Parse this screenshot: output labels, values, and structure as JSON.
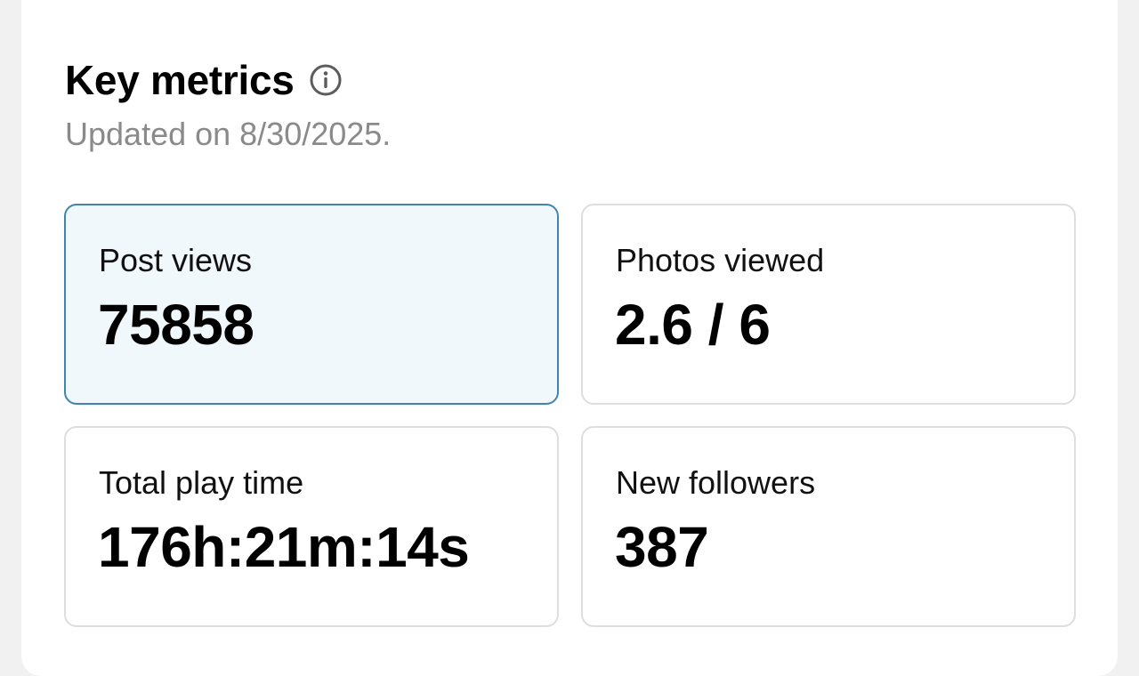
{
  "header": {
    "title": "Key metrics",
    "info_icon": "info-circle-icon",
    "updated_text": "Updated on 8/30/2025."
  },
  "colors": {
    "selected_card_bg": "#f1f8fb",
    "selected_card_border": "#3f85ac",
    "card_border": "#dedede",
    "subtitle_text": "#8a8a8a"
  },
  "metrics": [
    {
      "label": "Post views",
      "value": "75858",
      "selected": true
    },
    {
      "label": "Photos viewed",
      "value": "2.6 / 6",
      "selected": false
    },
    {
      "label": "Total play time",
      "value": "176h:21m:14s",
      "selected": false
    },
    {
      "label": "New followers",
      "value": "387",
      "selected": false
    }
  ]
}
